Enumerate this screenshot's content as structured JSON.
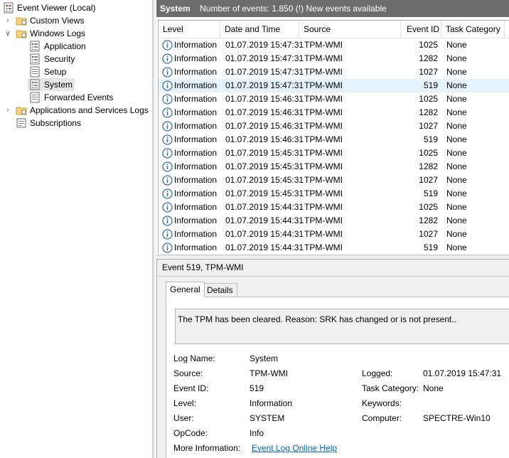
{
  "tree": {
    "root": "Event Viewer (Local)",
    "custom_views": "Custom Views",
    "windows_logs": "Windows Logs",
    "application": "Application",
    "security": "Security",
    "setup": "Setup",
    "system": "System",
    "forwarded": "Forwarded Events",
    "app_services": "Applications and Services Logs",
    "subscriptions": "Subscriptions"
  },
  "header": {
    "title": "System",
    "count": "Number of events: 1.850 (!) New events available"
  },
  "columns": {
    "level": "Level",
    "date": "Date and Time",
    "source": "Source",
    "event_id": "Event ID",
    "category": "Task Category"
  },
  "events": [
    {
      "level": "Information",
      "date": "01.07.2019 15:47:31",
      "source": "TPM-WMI",
      "id": "1025",
      "category": "None"
    },
    {
      "level": "Information",
      "date": "01.07.2019 15:47:31",
      "source": "TPM-WMI",
      "id": "1282",
      "category": "None"
    },
    {
      "level": "Information",
      "date": "01.07.2019 15:47:31",
      "source": "TPM-WMI",
      "id": "1027",
      "category": "None"
    },
    {
      "level": "Information",
      "date": "01.07.2019 15:47:31",
      "source": "TPM-WMI",
      "id": "519",
      "category": "None"
    },
    {
      "level": "Information",
      "date": "01.07.2019 15:46:31",
      "source": "TPM-WMI",
      "id": "1025",
      "category": "None"
    },
    {
      "level": "Information",
      "date": "01.07.2019 15:46:31",
      "source": "TPM-WMI",
      "id": "1282",
      "category": "None"
    },
    {
      "level": "Information",
      "date": "01.07.2019 15:46:31",
      "source": "TPM-WMI",
      "id": "1027",
      "category": "None"
    },
    {
      "level": "Information",
      "date": "01.07.2019 15:46:31",
      "source": "TPM-WMI",
      "id": "519",
      "category": "None"
    },
    {
      "level": "Information",
      "date": "01.07.2019 15:45:31",
      "source": "TPM-WMI",
      "id": "1025",
      "category": "None"
    },
    {
      "level": "Information",
      "date": "01.07.2019 15:45:31",
      "source": "TPM-WMI",
      "id": "1282",
      "category": "None"
    },
    {
      "level": "Information",
      "date": "01.07.2019 15:45:31",
      "source": "TPM-WMI",
      "id": "1027",
      "category": "None"
    },
    {
      "level": "Information",
      "date": "01.07.2019 15:45:31",
      "source": "TPM-WMI",
      "id": "519",
      "category": "None"
    },
    {
      "level": "Information",
      "date": "01.07.2019 15:44:31",
      "source": "TPM-WMI",
      "id": "1025",
      "category": "None"
    },
    {
      "level": "Information",
      "date": "01.07.2019 15:44:31",
      "source": "TPM-WMI",
      "id": "1282",
      "category": "None"
    },
    {
      "level": "Information",
      "date": "01.07.2019 15:44:31",
      "source": "TPM-WMI",
      "id": "1027",
      "category": "None"
    },
    {
      "level": "Information",
      "date": "01.07.2019 15:44:31",
      "source": "TPM-WMI",
      "id": "519",
      "category": "None"
    }
  ],
  "selected_row": 3,
  "detail": {
    "title": "Event 519, TPM-WMI",
    "tab_general": "General",
    "tab_details": "Details",
    "description": "The TPM has been cleared. Reason: SRK has changed or is not present..",
    "labels": {
      "log_name": "Log Name:",
      "source": "Source:",
      "event_id": "Event ID:",
      "level": "Level:",
      "user": "User:",
      "opcode": "OpCode:",
      "more_info": "More Information:",
      "logged": "Logged:",
      "task_category": "Task Category:",
      "keywords": "Keywords:",
      "computer": "Computer:"
    },
    "values": {
      "log_name": "System",
      "source": "TPM-WMI",
      "event_id": "519",
      "level": "Information",
      "user": "SYSTEM",
      "opcode": "Info",
      "more_info_link": "Event Log Online Help",
      "logged": "01.07.2019 15:47:31",
      "task_category": "None",
      "keywords": "",
      "computer": "SPECTRE-Win10"
    }
  },
  "colors": {
    "header_bg": "#6d6d6d",
    "selected_row_bg": "#e5f3ff",
    "link": "#0066cc",
    "info_icon": "#3a6ea5"
  }
}
